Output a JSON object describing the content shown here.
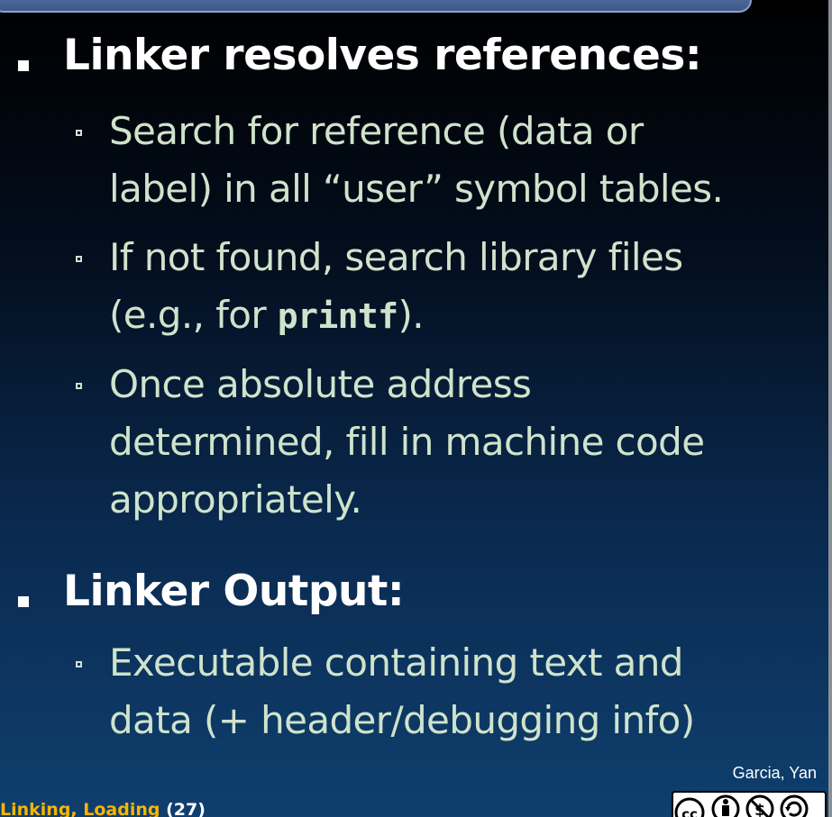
{
  "slide": {
    "bullets": [
      {
        "title": "Linker resolves references:",
        "sub": [
          {
            "lines": [
              "Search for reference (data or",
              "label) in all “user” symbol tables."
            ]
          },
          {
            "lines": [
              "If not found, search library files"
            ],
            "line2_pre": "(e.g., for ",
            "line2_code": "printf",
            "line2_post": ")."
          },
          {
            "lines": [
              "Once absolute address",
              "determined, fill in machine code",
              "appropriately."
            ]
          }
        ]
      },
      {
        "title": "Linker Output:",
        "sub": [
          {
            "lines": [
              "Executable containing text and",
              "data (+ header/debugging info)"
            ]
          }
        ]
      }
    ]
  },
  "footer": {
    "author": "Garcia, Yan",
    "title": "Linking, Loading",
    "page": "(27)",
    "license_icon": "cc-by-nc-sa-icon"
  }
}
